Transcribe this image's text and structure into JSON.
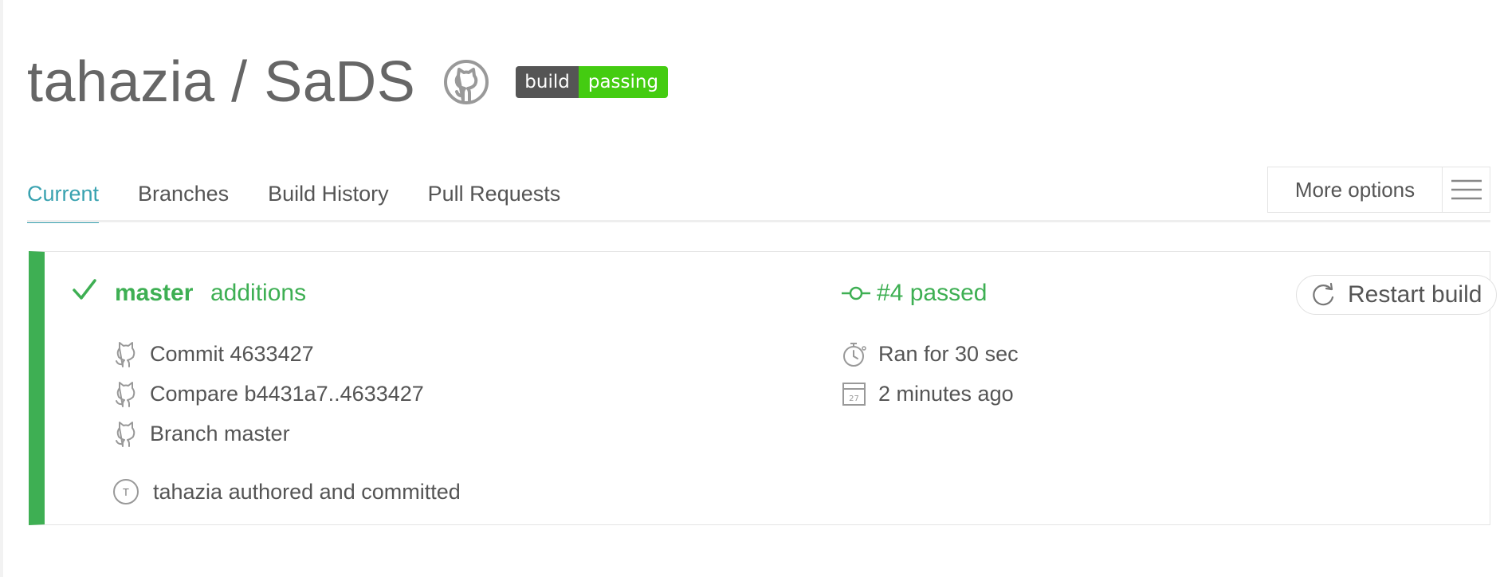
{
  "header": {
    "owner": "tahazia",
    "separator": " / ",
    "repo": "SaDS",
    "badge_left": "build",
    "badge_right": "passing"
  },
  "tabs": [
    {
      "label": "Current",
      "active": true
    },
    {
      "label": "Branches",
      "active": false
    },
    {
      "label": "Build History",
      "active": false
    },
    {
      "label": "Pull Requests",
      "active": false
    }
  ],
  "more_options": {
    "label": "More options"
  },
  "build": {
    "branch": "master",
    "message": "additions",
    "status": "#4 passed",
    "restart_label": "Restart build",
    "commit_label": "Commit 4633427",
    "compare_label": "Compare b4431a7..4633427",
    "branch_label": "Branch master",
    "duration_label": "Ran for 30 sec",
    "time_label": "2 minutes ago",
    "calendar_day": "27",
    "author_initial": "T",
    "author_label": "tahazia authored and committed"
  },
  "colors": {
    "accent": "#39a2b0",
    "passed": "#3eaf53",
    "badge_dark": "#555555",
    "badge_green": "#44cc11"
  }
}
